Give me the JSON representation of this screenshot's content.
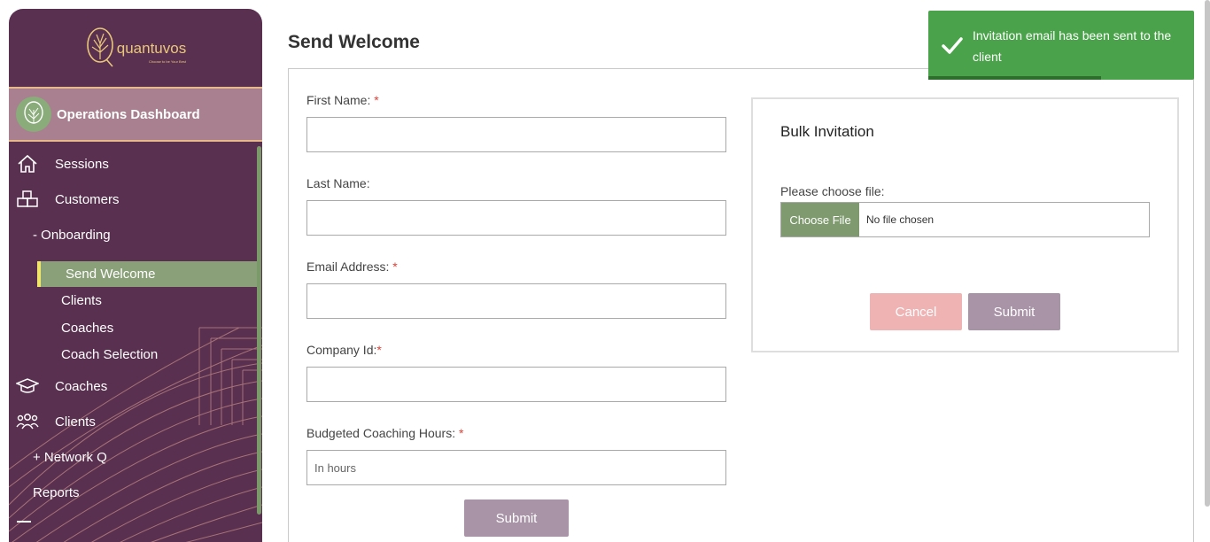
{
  "sidebar": {
    "logo": {
      "name": "quantuvos",
      "tagline": "Choose to be Your Best"
    },
    "dashboard_label": "Operations Dashboard",
    "items": {
      "sessions": "Sessions",
      "customers": "Customers",
      "onboarding": "- Onboarding",
      "send_welcome": "Send Welcome",
      "clients_sub": "Clients",
      "coaches_sub": "Coaches",
      "coach_selection": "Coach Selection",
      "coaches": "Coaches",
      "clients": "Clients",
      "network_q": "+ Network Q",
      "reports": "Reports"
    }
  },
  "page": {
    "title": "Send Welcome"
  },
  "form": {
    "first_name_label": "First Name:",
    "last_name_label": "Last Name:",
    "email_label": "Email Address:",
    "company_label": "Company Id:",
    "hours_label": "Budgeted Coaching Hours:",
    "required_mark": "*",
    "hours_placeholder": "In hours",
    "submit_label": "Submit"
  },
  "bulk": {
    "title": "Bulk Invitation",
    "file_label": "Please choose file:",
    "choose_file_label": "Choose File",
    "no_file_text": "No file chosen",
    "cancel_label": "Cancel",
    "submit_label": "Submit"
  },
  "toast": {
    "message": "Invitation email has been sent to the client",
    "progress": 0.65
  },
  "colors": {
    "sidebar_bg": "#59304f",
    "active_item": "#8aa079",
    "toast_bg": "#4aa34a",
    "submit_bg": "#a993a7",
    "cancel_bg": "#f0b3b3",
    "required": "#d9443a"
  },
  "icons": {
    "sessions": "home-icon",
    "customers": "boxes-icon",
    "coaches": "graduation-cap-icon",
    "clients": "users-icon",
    "toast": "check-icon"
  }
}
